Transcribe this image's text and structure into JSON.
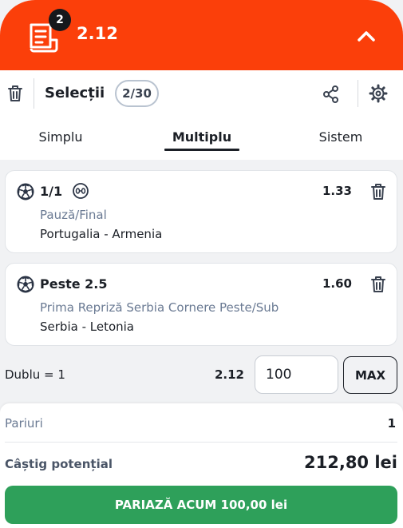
{
  "header": {
    "selection_badge": "2",
    "total_odds": "2.12",
    "icons": {
      "ticket": "ticket-icon",
      "collapse": "chevron-up-icon"
    },
    "colors": {
      "background": "#fb3f0a",
      "badge": "#16181c"
    }
  },
  "toolbar": {
    "title": "Selecții",
    "count": "2/30",
    "icons": {
      "delete_all": "trash-icon",
      "share": "share-icon",
      "settings": "gear-icon"
    }
  },
  "tabs": [
    {
      "label": "Simplu",
      "active": false
    },
    {
      "label": "Multiplu",
      "active": true
    },
    {
      "label": "Sistem",
      "active": false
    }
  ],
  "selections": [
    {
      "pick": "1/1",
      "odds": "1.33",
      "market": "Pauză/Final",
      "event": "Portugalia - Armenia",
      "icons": [
        "football-icon",
        "score-icon",
        "trash-icon"
      ]
    },
    {
      "pick": "Peste 2.5",
      "odds": "1.60",
      "market": "Prima Repriză Serbia Cornere Peste/Sub",
      "event": "Serbia - Letonia",
      "icons": [
        "football-icon",
        "trash-icon"
      ]
    }
  ],
  "stake": {
    "combo_label": "Dublu = 1",
    "combo_odds": "2.12",
    "amount": "100",
    "max_label": "MAX"
  },
  "summary": {
    "bets_label": "Pariuri",
    "bets_value": "1",
    "win_label": "Câștig potențial",
    "win_value": "212,80 lei",
    "place_label": "PARIAZĂ ACUM 100,00 lei",
    "colors": {
      "place_button": "#2ea05a",
      "market_text": "#6a7a93"
    }
  }
}
